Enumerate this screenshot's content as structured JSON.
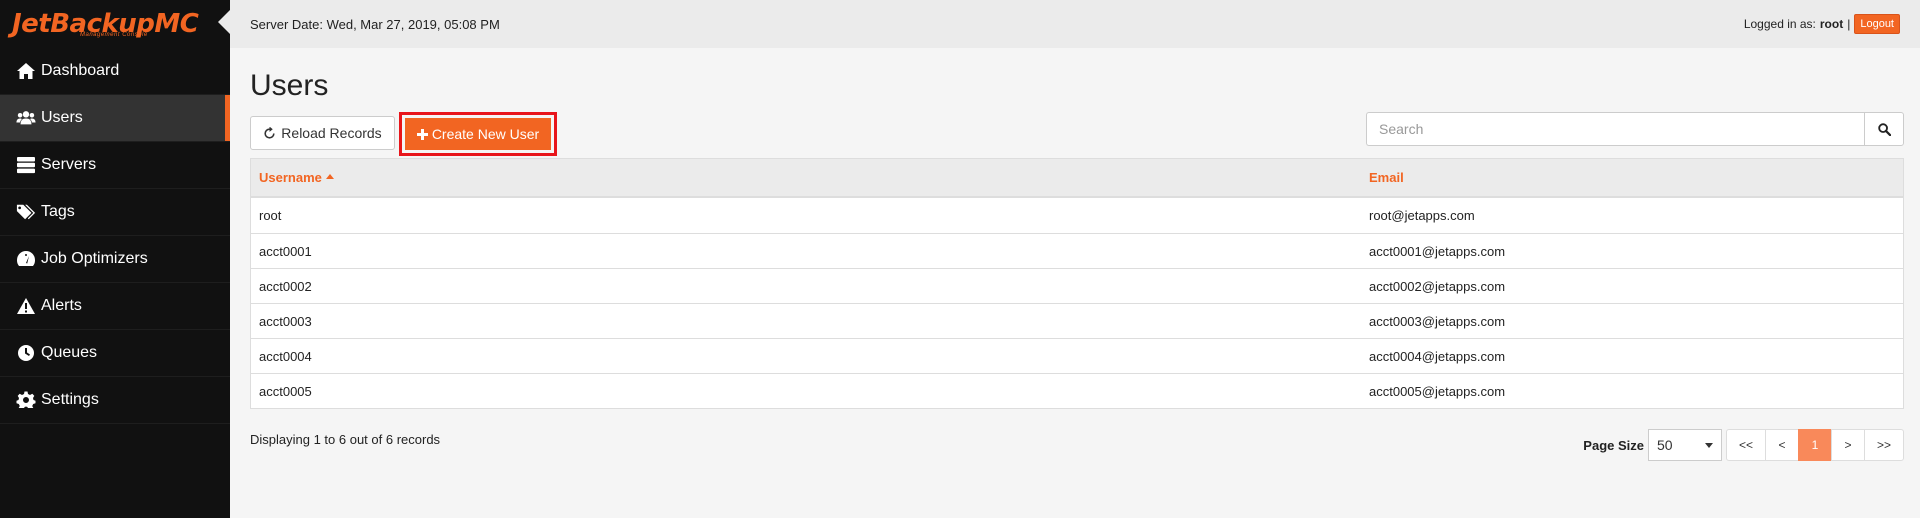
{
  "brand": {
    "logo": "JetBackupMC",
    "subtitle": "Management Console",
    "accent": "#f26522"
  },
  "topbar": {
    "server_date": "Server Date: Wed, Mar 27, 2019, 05:08 PM",
    "logged_in_label": "Logged in as:",
    "username": "root",
    "separator": "|",
    "logout_label": "Logout"
  },
  "sidebar": {
    "items": [
      {
        "label": "Dashboard",
        "icon": "home-icon"
      },
      {
        "label": "Users",
        "icon": "users-icon",
        "active": true
      },
      {
        "label": "Servers",
        "icon": "server-icon"
      },
      {
        "label": "Tags",
        "icon": "tags-icon"
      },
      {
        "label": "Job Optimizers",
        "icon": "dashboard-gauge-icon"
      },
      {
        "label": "Alerts",
        "icon": "warning-icon"
      },
      {
        "label": "Queues",
        "icon": "clock-icon"
      },
      {
        "label": "Settings",
        "icon": "gear-icon"
      }
    ]
  },
  "main": {
    "title": "Users",
    "reload_label": "Reload Records",
    "create_label": "Create New User",
    "search_placeholder": "Search"
  },
  "table": {
    "columns": [
      "Username",
      "Email"
    ],
    "sorted_column": "Username",
    "rows": [
      {
        "username": "root",
        "email": "root@jetapps.com"
      },
      {
        "username": "acct0001",
        "email": "acct0001@jetapps.com"
      },
      {
        "username": "acct0002",
        "email": "acct0002@jetapps.com"
      },
      {
        "username": "acct0003",
        "email": "acct0003@jetapps.com"
      },
      {
        "username": "acct0004",
        "email": "acct0004@jetapps.com"
      },
      {
        "username": "acct0005",
        "email": "acct0005@jetapps.com"
      }
    ]
  },
  "footer": {
    "records_info": "Displaying 1 to 6 out of 6 records",
    "page_size_label": "Page Size",
    "page_size_value": "50",
    "pager": {
      "first": "<<",
      "prev": "<",
      "current": "1",
      "next": ">",
      "last": ">>"
    }
  }
}
